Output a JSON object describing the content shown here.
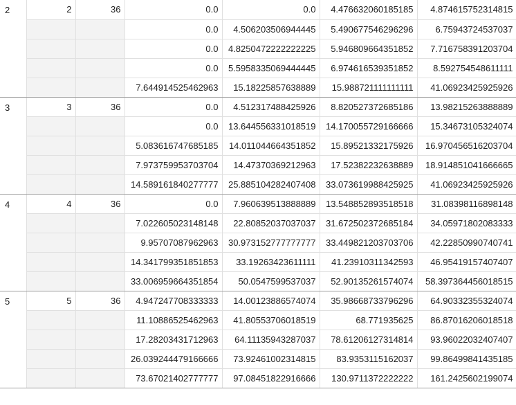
{
  "table": {
    "groups": [
      {
        "group": "2",
        "index": "2",
        "count": "36",
        "rows": [
          [
            "0.0",
            "0.0",
            "4.476632060185185",
            "4.874615752314815"
          ],
          [
            "0.0",
            "4.506203506944445",
            "5.490677546296296",
            "6.75943724537037"
          ],
          [
            "0.0",
            "4.8250472222222225",
            "5.946809664351852",
            "7.716758391203704"
          ],
          [
            "0.0",
            "5.5958335069444445",
            "6.974616539351852",
            "8.592754548611111"
          ],
          [
            "7.644914525462963",
            "15.18225857638889",
            "15.988721111111111",
            "41.06923425925926"
          ]
        ]
      },
      {
        "group": "3",
        "index": "3",
        "count": "36",
        "rows": [
          [
            "0.0",
            "4.512317488425926",
            "8.820527372685186",
            "13.98215263888889"
          ],
          [
            "0.0",
            "13.644556331018519",
            "14.170055729166666",
            "15.34673105324074"
          ],
          [
            "5.083616747685185",
            "14.011044664351852",
            "15.89521332175926",
            "16.970456516203704"
          ],
          [
            "7.973759953703704",
            "14.47370369212963",
            "17.52382232638889",
            "18.914851041666665"
          ],
          [
            "14.589161840277777",
            "25.885104282407408",
            "33.073619988425925",
            "41.06923425925926"
          ]
        ]
      },
      {
        "group": "4",
        "index": "4",
        "count": "36",
        "rows": [
          [
            "0.0",
            "7.960639513888889",
            "13.548852893518518",
            "31.08398116898148"
          ],
          [
            "7.022605023148148",
            "22.80852037037037",
            "31.672502372685184",
            "34.05971802083333"
          ],
          [
            "9.95707087962963",
            "30.973152777777777",
            "33.449821203703706",
            "42.22850990740741"
          ],
          [
            "14.341799351851853",
            "33.19263423611111",
            "41.23910311342593",
            "46.95419157407407"
          ],
          [
            "33.006959664351854",
            "50.0547599537037",
            "52.90135261574074",
            "58.397364456018515"
          ]
        ]
      },
      {
        "group": "5",
        "index": "5",
        "count": "36",
        "rows": [
          [
            "4.947247708333333",
            "14.00123886574074",
            "35.98668733796296",
            "64.90332355324074"
          ],
          [
            "11.10886525462963",
            "41.80553706018519",
            "68.771935625",
            "86.87016206018518"
          ],
          [
            "17.28203431712963",
            "64.11135943287037",
            "78.61206127314814",
            "93.96022032407407"
          ],
          [
            "26.039244479166666",
            "73.92461002314815",
            "83.9353115162037",
            "99.86499841435185"
          ],
          [
            "73.67021402777777",
            "97.08451822916666",
            "130.9711372222222",
            "161.2425602199074"
          ]
        ]
      }
    ]
  }
}
